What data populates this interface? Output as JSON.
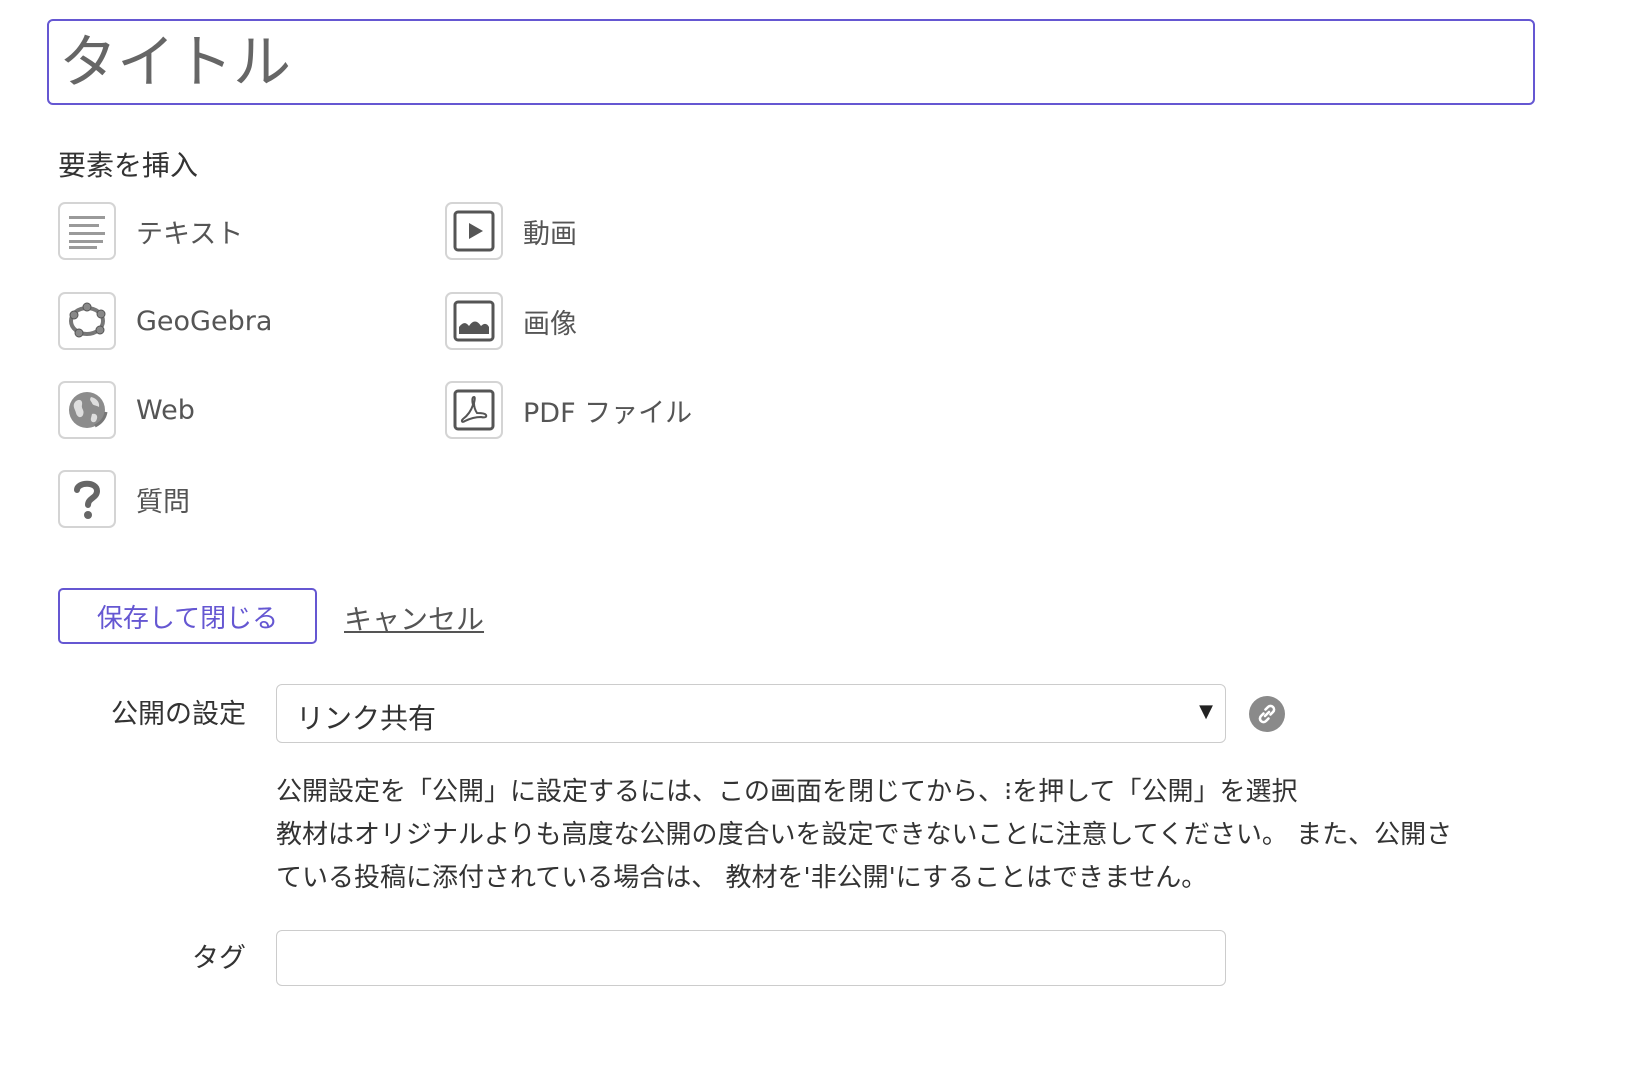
{
  "title_field": {
    "placeholder": "タイトル",
    "value": "",
    "border_color": "#6557d2"
  },
  "insert_elements": {
    "heading": "要素を挿入",
    "items": [
      {
        "label": "テキスト",
        "icon": "text-lines-icon"
      },
      {
        "label": "動画",
        "icon": "video-play-icon"
      },
      {
        "label": "GeoGebra",
        "icon": "geogebra-icon"
      },
      {
        "label": "画像",
        "icon": "image-icon"
      },
      {
        "label": "Web",
        "icon": "globe-icon"
      },
      {
        "label": "PDF ファイル",
        "icon": "pdf-icon"
      },
      {
        "label": "質問",
        "icon": "question-icon"
      }
    ]
  },
  "actions": {
    "save_label": "保存して閉じる",
    "cancel_label": "キャンセル",
    "accent_color": "#6557d2"
  },
  "visibility": {
    "label": "公開の設定",
    "selected": "リンク共有",
    "icon": "link-icon",
    "info_lines": [
      "公開設定を「公開」に設定するには、この画面を閉じてから、⁝を押して「公開」を選択",
      "教材はオリジナルよりも高度な公開の度合いを設定できないことに注意してください。 また、公開さ",
      "ている投稿に添付されている場合は、 教材を'非公開'にすることはできません。"
    ]
  },
  "tags": {
    "label": "タグ",
    "value": ""
  }
}
